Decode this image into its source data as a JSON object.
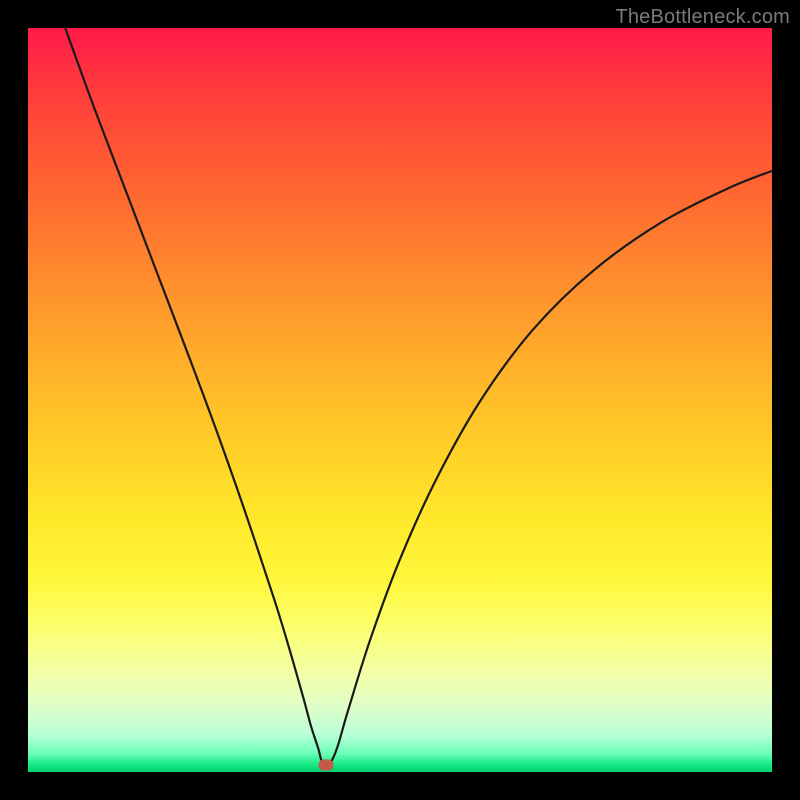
{
  "watermark": "TheBottleneck.com",
  "colors": {
    "frame_border": "#000000",
    "curve_stroke": "#1a1a1a",
    "marker": "#c45a4a"
  },
  "chart_data": {
    "type": "line",
    "title": "",
    "xlabel": "",
    "ylabel": "",
    "xlim": [
      0,
      100
    ],
    "ylim": [
      0,
      100
    ],
    "grid": false,
    "legend": false,
    "annotations": [],
    "series": [
      {
        "name": "bottleneck-curve",
        "x": [
          5,
          9,
          13,
          17,
          21,
          25,
          29,
          33,
          35,
          37,
          38,
          39,
          39.6,
          40.6,
          41.6,
          43,
          46,
          50,
          55,
          61,
          68,
          76,
          85,
          94,
          100
        ],
        "y": [
          100,
          89,
          78.5,
          68,
          57.5,
          46.8,
          35.5,
          23.5,
          17,
          10,
          6.3,
          3.2,
          1.2,
          1.2,
          3.4,
          8.2,
          17.8,
          28.6,
          39.6,
          50.2,
          59.6,
          67.4,
          73.8,
          78.4,
          80.8
        ]
      }
    ],
    "marker": {
      "x": 40.1,
      "y": 0.9
    }
  }
}
